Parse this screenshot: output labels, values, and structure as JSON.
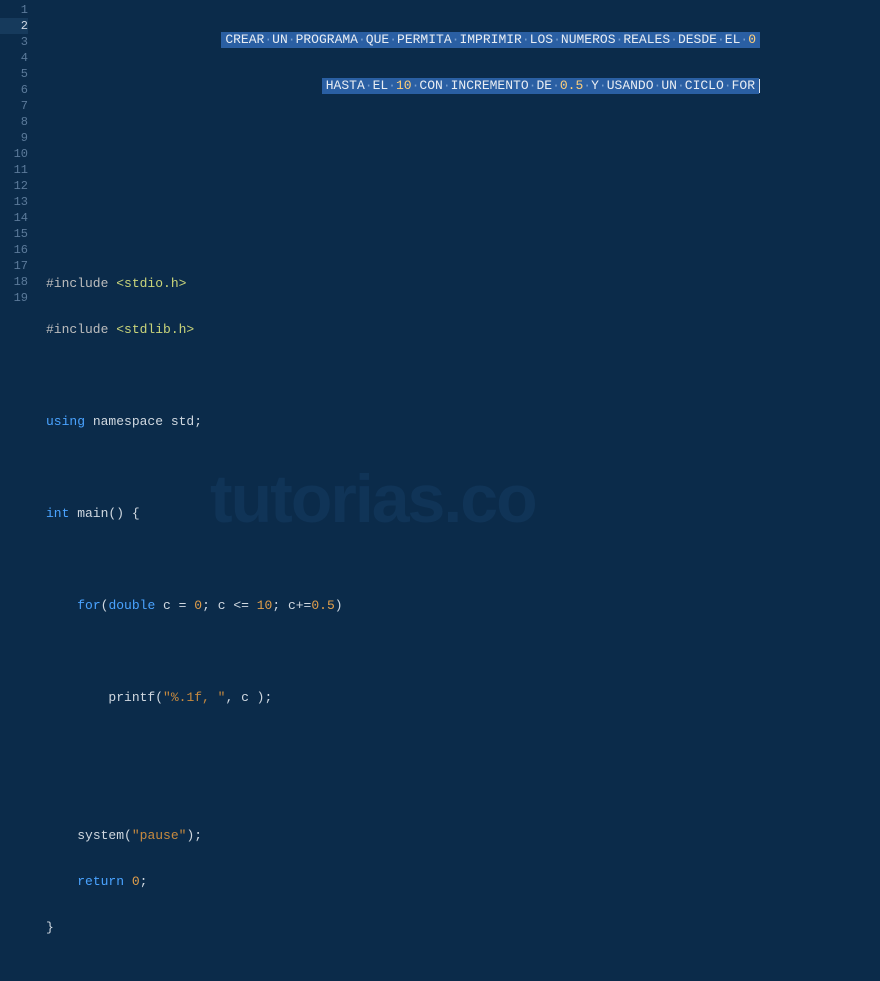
{
  "watermark": "tutorias.co",
  "lineCount": 19,
  "activeLine": 2,
  "comment": {
    "l1_parts": [
      "CREAR",
      "UN",
      "PROGRAMA",
      "QUE",
      "PERMITA",
      "IMPRIMIR",
      "LOS",
      "NUMEROS",
      "REALES",
      "DESDE",
      "EL"
    ],
    "l1_tail": "0",
    "l2_parts_a": [
      "HASTA",
      "EL"
    ],
    "l2_num1": "10",
    "l2_parts_b": [
      "CON",
      "INCREMENTO",
      "DE"
    ],
    "l2_num2": "0.5",
    "l2_parts_c": [
      "Y",
      "USANDO",
      "UN",
      "CICLO",
      "FOR"
    ]
  },
  "code": {
    "inc1_a": "#include ",
    "inc1_b": "<stdio.h>",
    "inc2_a": "#include ",
    "inc2_b": "<stdlib.h>",
    "using_a": "using",
    "using_b": " namespace std",
    "using_c": ";",
    "main_a": "int",
    "main_b": " main",
    "main_c": "()",
    "main_d": " {",
    "for_a": "for",
    "for_b": "(",
    "for_c": "double",
    "for_d": " c ",
    "for_e": "=",
    "for_f": " ",
    "for_n1": "0",
    "for_g": "; c ",
    "for_h": "<=",
    "for_i": " ",
    "for_n2": "10",
    "for_j": "; c",
    "for_k": "+=",
    "for_n3": "0.5",
    "for_l": ")",
    "printf_a": "printf",
    "printf_b": "(",
    "printf_str": "\"%.1f, \"",
    "printf_c": ", c )",
    "printf_d": ";",
    "sys_a": "system",
    "sys_b": "(",
    "sys_str": "\"pause\"",
    "sys_c": ")",
    "sys_d": ";",
    "ret_a": "return",
    "ret_b": " ",
    "ret_n": "0",
    "ret_c": ";",
    "brace": "}"
  }
}
